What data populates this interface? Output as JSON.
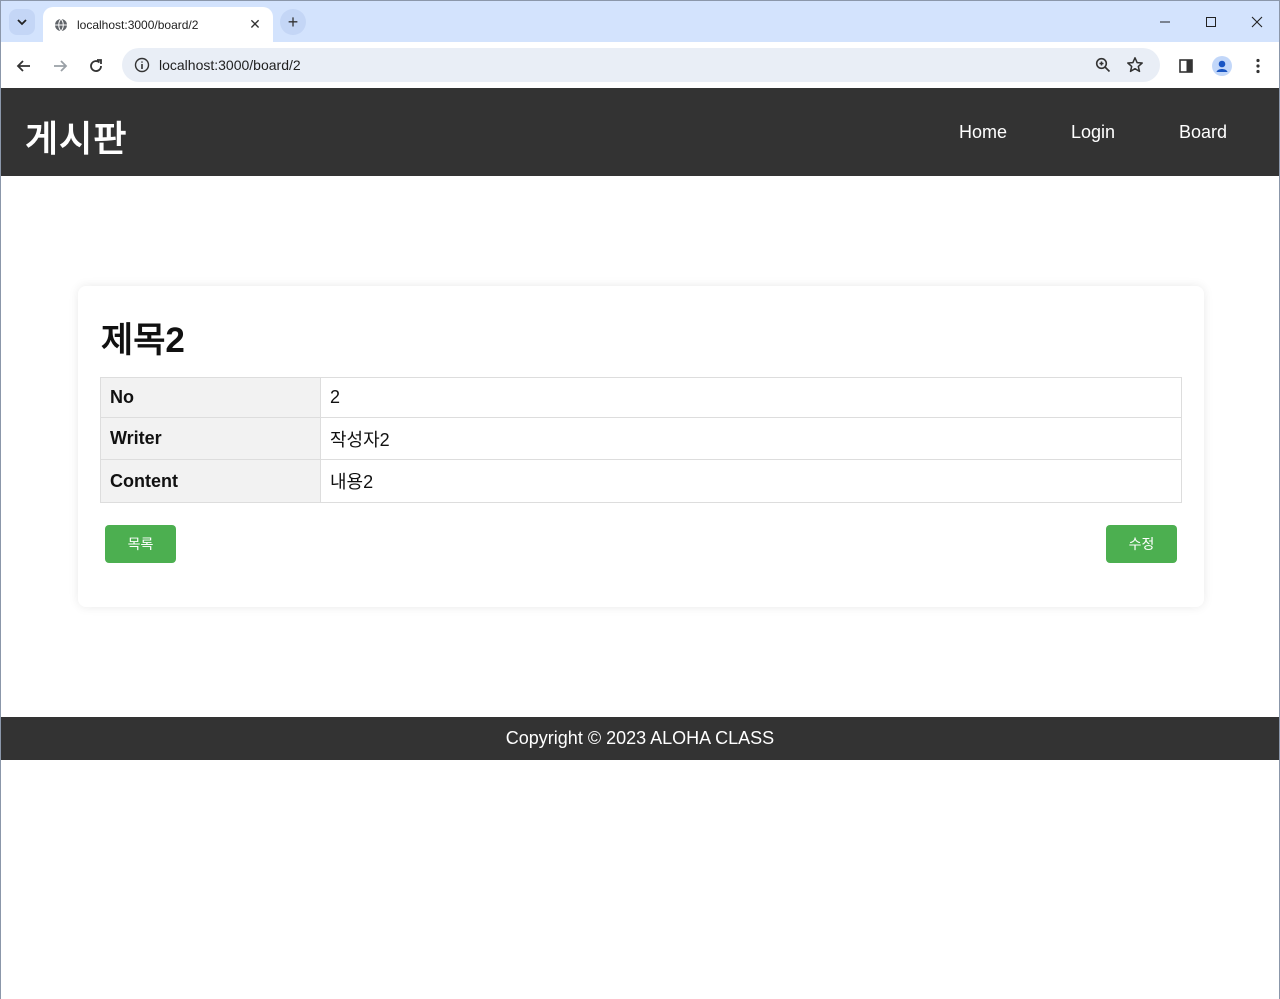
{
  "browser": {
    "tab_title": "localhost:3000/board/2",
    "tab_close": "✕",
    "new_tab": "+",
    "url": "localhost:3000/board/2"
  },
  "site": {
    "brand": "게시판",
    "nav": [
      {
        "label": "Home"
      },
      {
        "label": "Login"
      },
      {
        "label": "Board"
      }
    ]
  },
  "post": {
    "title": "제목2",
    "fields": [
      {
        "label": "No",
        "value": "2"
      },
      {
        "label": "Writer",
        "value": "작성자2"
      },
      {
        "label": "Content",
        "value": "내용2"
      }
    ],
    "buttons": {
      "list": "목록",
      "edit": "수정"
    }
  },
  "footer": {
    "copyright": "Copyright © 2023 ALOHA CLASS"
  },
  "colors": {
    "header_bg": "#333333",
    "button_green": "#4caf50",
    "chrome_bg": "#d3e3fd"
  }
}
